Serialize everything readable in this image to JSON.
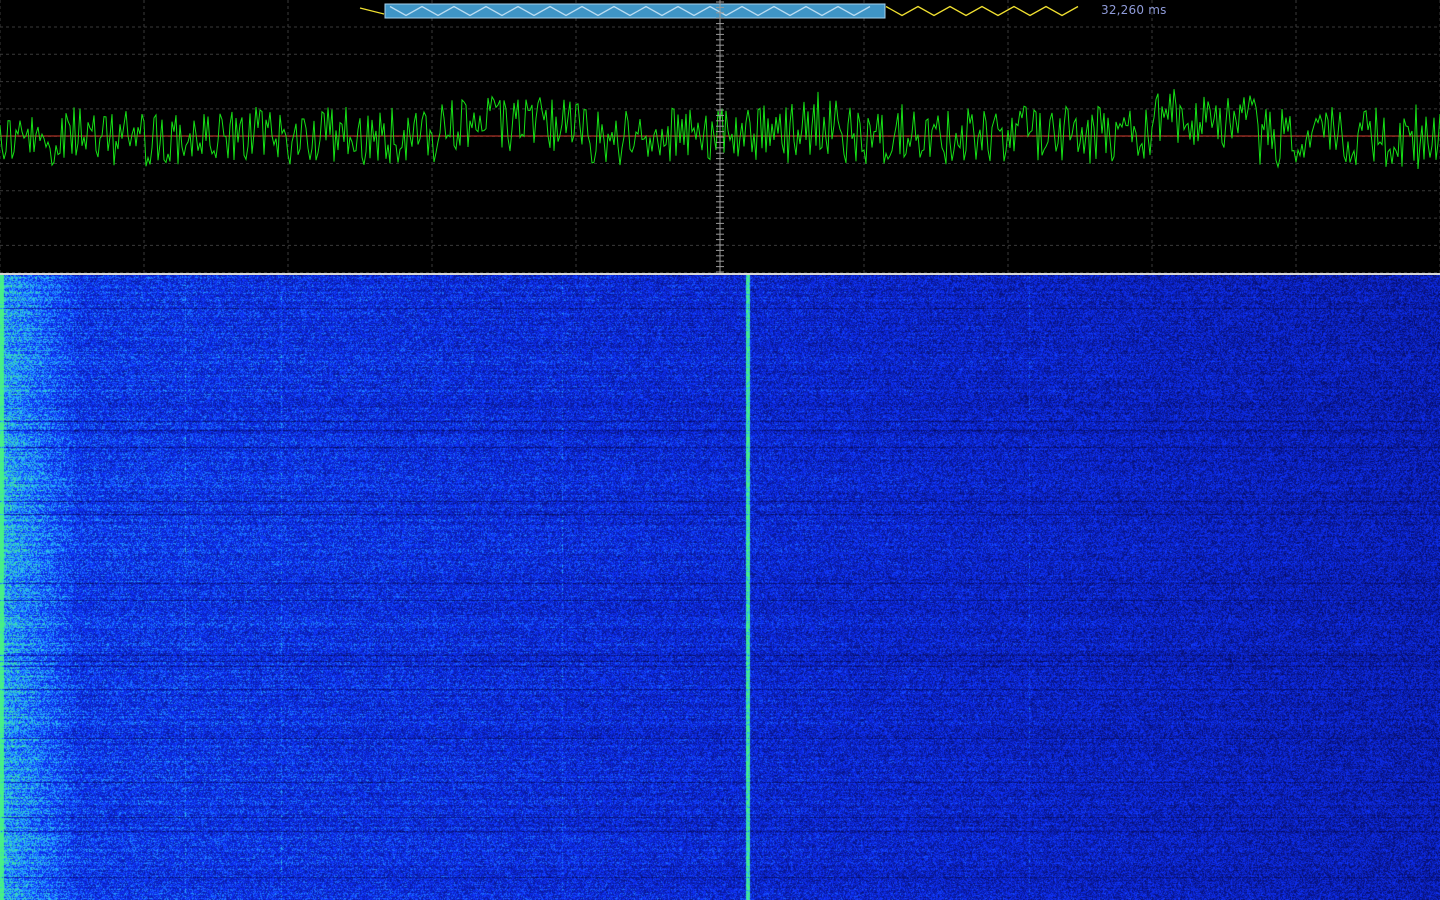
{
  "scope": {
    "time_readout": "32,260 ms",
    "colors": {
      "background": "#000000",
      "grid": "#3a3a3a",
      "center_marker": "#9a9a9a",
      "baseline": "#d23b2b",
      "signal": "#16e016",
      "scroll_indicator": "#f0e030",
      "viewport_box": "#3f95c6"
    }
  },
  "waterfall": {
    "colors": {
      "background": "#0a0f7a",
      "noise_low": "#0014c8",
      "noise_high": "#2a6cff",
      "peak": "#22d4a0"
    },
    "palette": "blue-green"
  }
}
